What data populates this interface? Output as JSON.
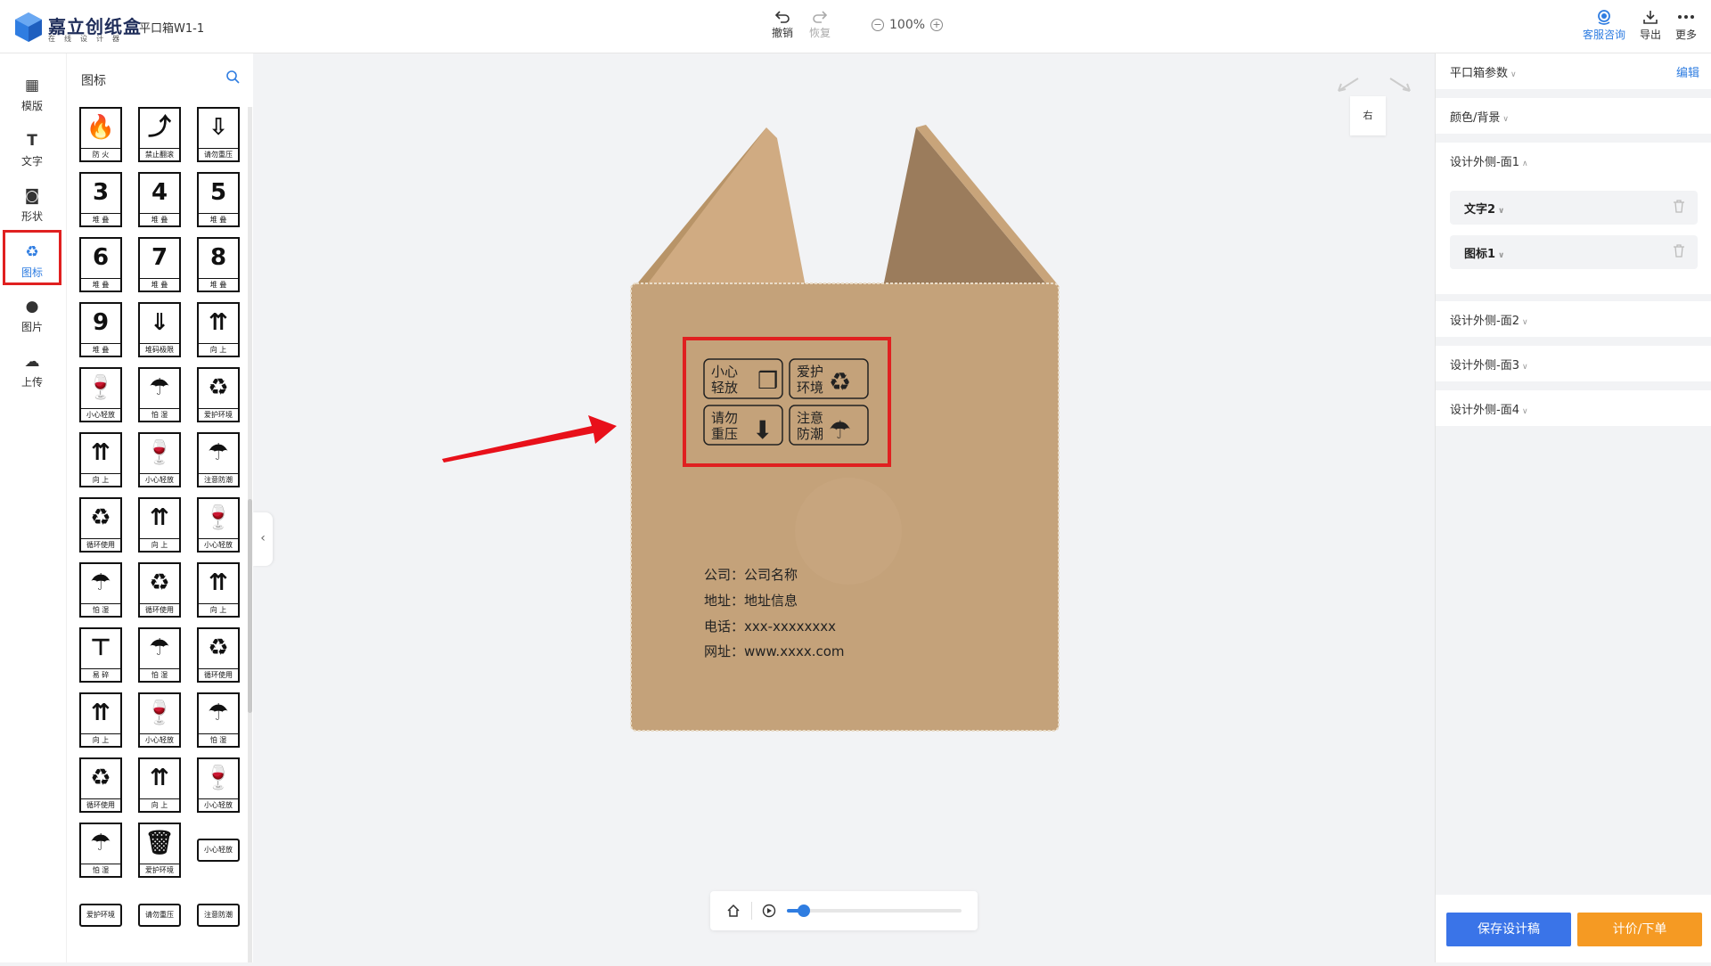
{
  "app": {
    "brand": "嘉立创纸盒",
    "brand_sub": "在线设计器",
    "doc_name": "平口箱W1-1"
  },
  "toolbar": {
    "undo_label": "撤销",
    "redo_label": "恢复",
    "zoom": "100%",
    "support_label": "客服咨询",
    "export_label": "导出",
    "more_label": "更多"
  },
  "nav": {
    "items": [
      {
        "label": "模版",
        "icon": "template-icon"
      },
      {
        "label": "文字",
        "icon": "text-icon"
      },
      {
        "label": "形状",
        "icon": "shape-icon"
      },
      {
        "label": "图标",
        "icon": "recycle-icon",
        "active": true
      },
      {
        "label": "图片",
        "icon": "image-icon"
      },
      {
        "label": "上传",
        "icon": "upload-cloud-icon"
      }
    ]
  },
  "icon_panel": {
    "title": "图标",
    "icons": [
      {
        "glyph": "🔥",
        "caption": "防 火"
      },
      {
        "glyph": "⤴",
        "caption": "禁止翻滚"
      },
      {
        "glyph": "⇩",
        "caption": "请勿重压"
      },
      {
        "glyph": "3",
        "caption": "堆 叠"
      },
      {
        "glyph": "4",
        "caption": "堆 叠"
      },
      {
        "glyph": "5",
        "caption": "堆 叠"
      },
      {
        "glyph": "6",
        "caption": "堆 叠"
      },
      {
        "glyph": "7",
        "caption": "堆 叠"
      },
      {
        "glyph": "8",
        "caption": "堆 叠"
      },
      {
        "glyph": "9",
        "caption": "堆 叠"
      },
      {
        "glyph": "⇓",
        "caption": "堆码极限"
      },
      {
        "glyph": "⇈",
        "caption": "向 上"
      },
      {
        "glyph": "🍷",
        "caption": "小心轻放"
      },
      {
        "glyph": "☂",
        "caption": "怕 湿"
      },
      {
        "glyph": "♻",
        "caption": "爱护环境"
      },
      {
        "glyph": "⇈",
        "caption": "向 上"
      },
      {
        "glyph": "🍷",
        "caption": "小心轻放"
      },
      {
        "glyph": "☂",
        "caption": "注意防潮"
      },
      {
        "glyph": "♻",
        "caption": "循环使用"
      },
      {
        "glyph": "⇈",
        "caption": "向 上"
      },
      {
        "glyph": "🍷",
        "caption": "小心轻放"
      },
      {
        "glyph": "☂",
        "caption": "怕 湿"
      },
      {
        "glyph": "♻",
        "caption": "循环使用"
      },
      {
        "glyph": "⇈",
        "caption": "向 上"
      },
      {
        "glyph": "⊤",
        "caption": "易 碎"
      },
      {
        "glyph": "☂",
        "caption": "怕 湿"
      },
      {
        "glyph": "♻",
        "caption": "循环使用"
      },
      {
        "glyph": "⇈",
        "caption": "向 上"
      },
      {
        "glyph": "🍷",
        "caption": "小心轻放"
      },
      {
        "glyph": "☂",
        "caption": "怕 湿"
      },
      {
        "glyph": "♻",
        "caption": "循环使用"
      },
      {
        "glyph": "⇈",
        "caption": "向 上"
      },
      {
        "glyph": "🍷",
        "caption": "小心轻放"
      },
      {
        "glyph": "☂",
        "caption": "怕 湿"
      },
      {
        "glyph": "🗑",
        "caption": "爱护环境"
      },
      {
        "glyph": "小心轻放",
        "caption": ""
      },
      {
        "glyph": "爱护环境",
        "caption": ""
      },
      {
        "glyph": "请勿重压",
        "caption": ""
      },
      {
        "glyph": "注意防潮",
        "caption": ""
      }
    ]
  },
  "canvas": {
    "view_label": "右",
    "box_icons": [
      {
        "line1": "小心",
        "line2": "轻放",
        "glyph": "❒"
      },
      {
        "line1": "爱护",
        "line2": "环境",
        "glyph": "♻"
      },
      {
        "line1": "请勿",
        "line2": "重压",
        "glyph": "⬇"
      },
      {
        "line1": "注意",
        "line2": "防潮",
        "glyph": "☂"
      }
    ],
    "box_text": [
      "公司：公司名称",
      "地址：地址信息",
      "电话：xxx-xxxxxxxx",
      "网址：www.xxxx.com"
    ]
  },
  "right_panel": {
    "box_params": "平口箱参数",
    "edit_label": "编辑",
    "color_bg": "颜色/背景",
    "face1": "设计外侧-面1",
    "face1_items": [
      "文字2",
      "图标1"
    ],
    "face2": "设计外侧-面2",
    "face3": "设计外侧-面3",
    "face4": "设计外侧-面4",
    "save_label": "保存设计稿",
    "order_label": "计价/下单"
  },
  "colors": {
    "accent": "#2f7de1",
    "highlight": "#e02020",
    "cardboard": "#c4a27a",
    "save": "#3a74e8",
    "order": "#f59a23"
  }
}
